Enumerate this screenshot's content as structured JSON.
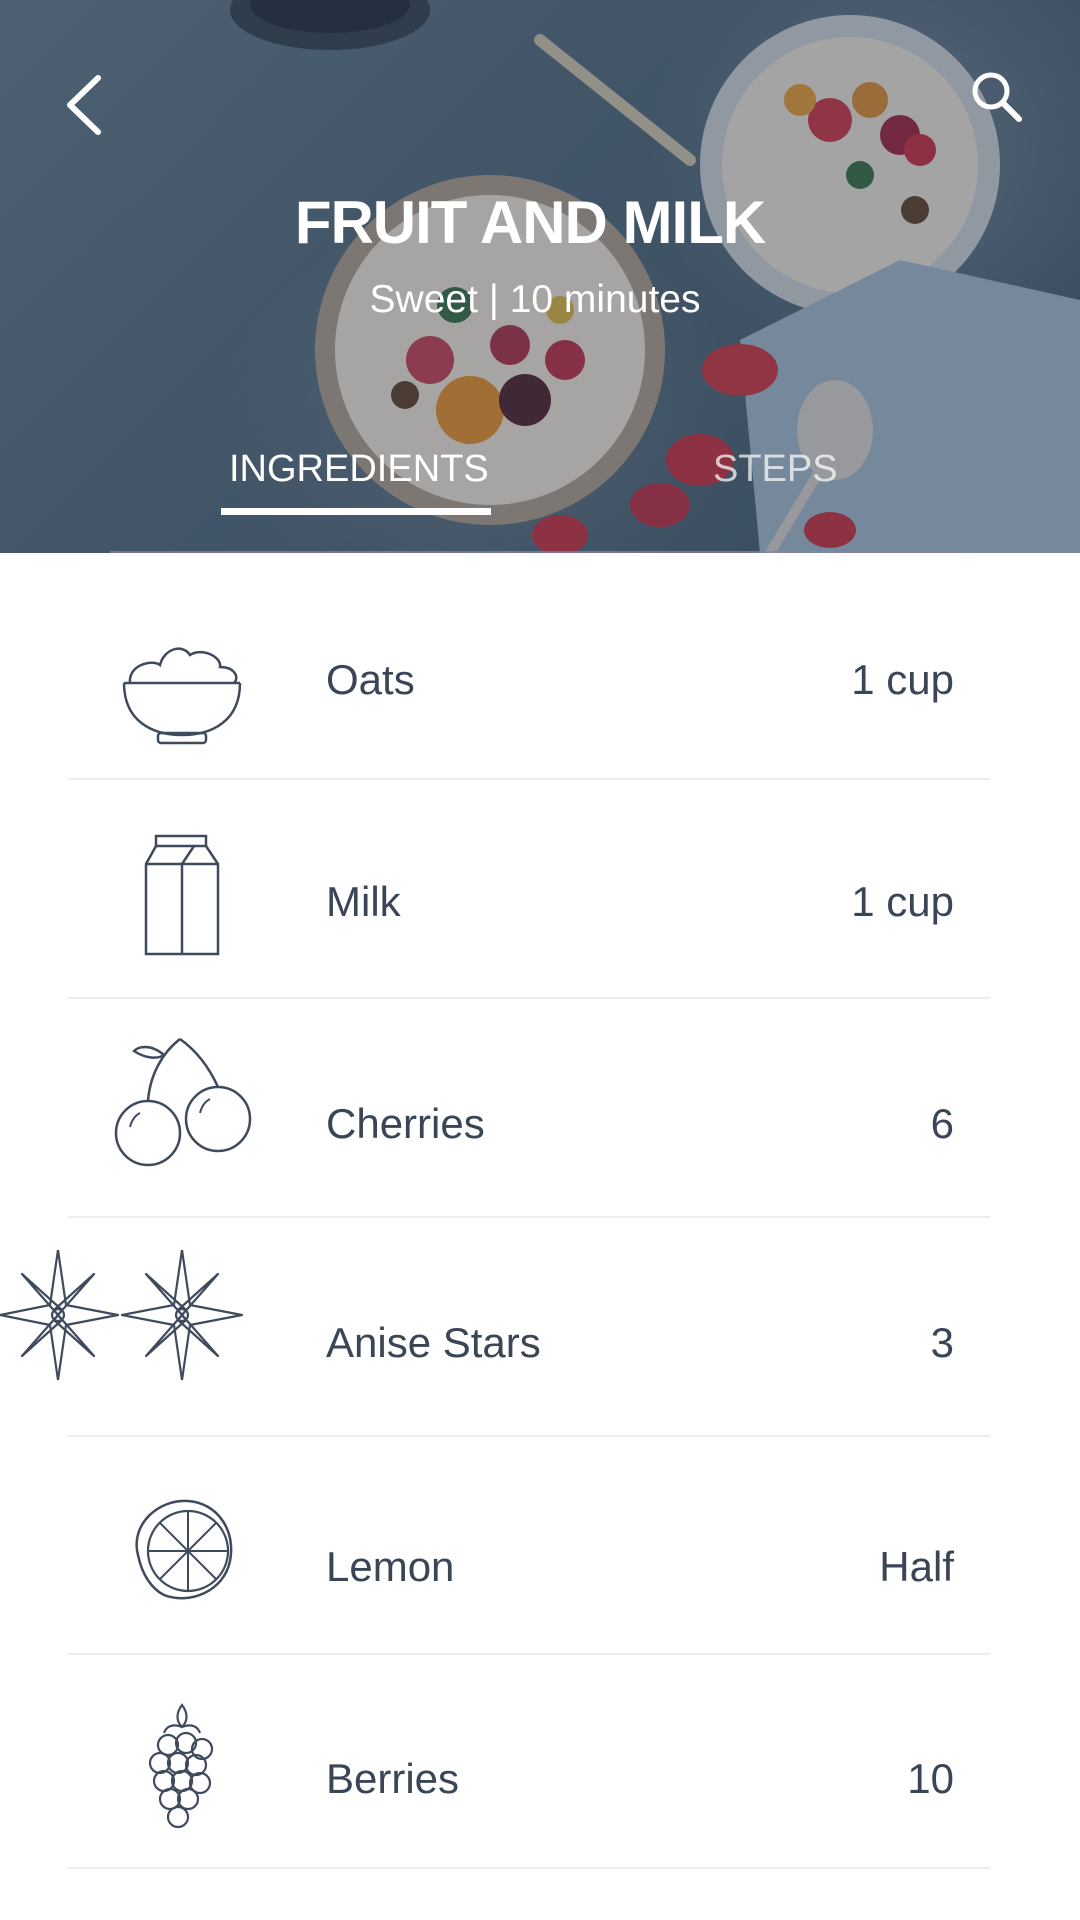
{
  "header": {
    "title": "FRUIT AND MILK",
    "subtitle": "Sweet | 10 minutes"
  },
  "tabs": [
    {
      "label": "INGREDIENTS",
      "active": true
    },
    {
      "label": "STEPS",
      "active": false
    }
  ],
  "ingredients": [
    {
      "name": "Oats",
      "quantity": "1 cup",
      "icon": "oats-bowl-icon"
    },
    {
      "name": "Milk",
      "quantity": "1 cup",
      "icon": "milk-carton-icon"
    },
    {
      "name": "Cherries",
      "quantity": "6",
      "icon": "cherries-icon"
    },
    {
      "name": "Anise Stars",
      "quantity": "3",
      "icon": "anise-stars-icon"
    },
    {
      "name": "Lemon",
      "quantity": "Half",
      "icon": "lemon-icon"
    },
    {
      "name": "Berries",
      "quantity": "10",
      "icon": "berries-icon"
    }
  ],
  "colors": {
    "text": "#3a4556",
    "icon_stroke": "#3f4a5c",
    "divider": "#eceef1",
    "tab_active": "#ffffff"
  }
}
